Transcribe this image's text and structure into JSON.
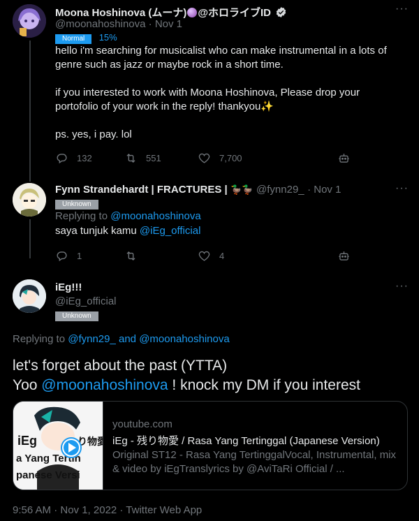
{
  "tweet1": {
    "name": "Moona Hoshinova (ムーナ)",
    "name_suffix": "@ホロライブID",
    "handle": "@moonahoshinova",
    "time": "· Nov 1",
    "badge": "Normal",
    "percent": "15%",
    "paragraph1": "hello i'm searching for musicalist who can make instrumental in a lots of genre such as jazz or maybe rock in a short time.",
    "paragraph2": "if you interested to work with Moona Hoshinova, Please drop your portofolio of your work in the reply! thankyou✨",
    "paragraph3": "ps. yes, i pay. lol",
    "replies": "132",
    "retweets": "551",
    "likes": "7,700"
  },
  "tweet2": {
    "name": "Fynn Strandehardt | FRACTURES |",
    "name_emoji": "🦆🦆",
    "handle": "@fynn29_",
    "time": "· Nov 1",
    "badge": "Unknown",
    "replying_prefix": "Replying to",
    "replying_to": "@moonahoshinova",
    "text": "saya tunjuk kamu",
    "mention": "@iEg_official",
    "replies": "1",
    "likes": "4"
  },
  "tweet3": {
    "name": "iEg!!!",
    "handle": "@iEg_official",
    "badge": "Unknown",
    "replying_prefix": "Replying to",
    "replying_user1": "@fynn29_",
    "replying_and": "and",
    "replying_user2": "@moonahoshinova",
    "line1": "let's forget about the past (YTTA)",
    "line2_pre": "Yoo",
    "line2_mention": "@moonahoshinova",
    "line2_post": "! knock my DM if you interest",
    "card": {
      "domain": "youtube.com",
      "title": "iEg - 残り物愛 / Rasa Yang Tertinggal (Japanese Version)",
      "desc1": "Original ST12 - Rasa Yang TertinggalVocal, Instrumental, mix",
      "desc2": "& video by iEgTranslyrics by @AviTaRi Official / ...",
      "thumb_text": "iEg 残り物愛 a Yang Tertin panese Versi"
    },
    "timestamp": "9:56 AM · Nov 1, 2022 · Twitter Web App"
  },
  "colors": {
    "background": "#000000",
    "text": "#e7e9ea",
    "muted": "#71767b",
    "accent": "#1d9bf0",
    "badge_unknown": "#9aa0a6",
    "divider": "#2f3336"
  },
  "icons": [
    "reply-icon",
    "retweet-icon",
    "like-icon",
    "robot-icon",
    "more-icon",
    "verified-icon",
    "play-icon"
  ]
}
